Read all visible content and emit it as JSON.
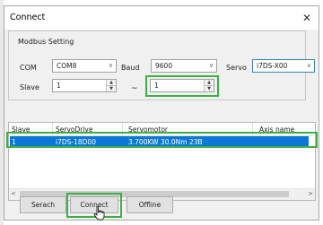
{
  "window": {
    "title": "Connect",
    "close_glyph": "✕"
  },
  "modbus": {
    "group_label": "Modbus Setting",
    "com_label": "COM",
    "com_value": "COM8",
    "baud_label": "Baud",
    "baud_value": "9600",
    "servo_label": "Servo",
    "servo_value": "i7DS-X00",
    "slave_label": "Slave",
    "slave_from": "1",
    "range_sep": "~",
    "slave_to": "1"
  },
  "table": {
    "columns": [
      "Slave",
      "ServoDrive",
      "Servomotor",
      "Axis name"
    ],
    "rows": [
      {
        "slave": "1",
        "servo_drive": "i7DS-18D00",
        "servomotor": "3.700KW 30.0Nm 23B",
        "axis_name": ""
      }
    ],
    "scroll_left": "<",
    "scroll_right": ">"
  },
  "buttons": {
    "search": "Serach",
    "connect": "Connect",
    "offline": "Offline"
  },
  "colors": {
    "highlight": "#3cb043",
    "selection": "#0b78d8"
  }
}
